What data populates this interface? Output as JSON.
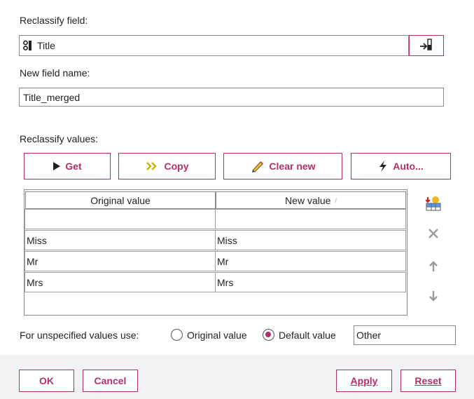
{
  "reclassify_field": {
    "label": "Reclassify field:",
    "value": "Title",
    "field_icon": "nominal-field-icon",
    "picker_icon": "field-picker-icon"
  },
  "new_field_name": {
    "label": "New field name:",
    "value": "Title_merged"
  },
  "reclassify_values": {
    "label": "Reclassify values:",
    "buttons": {
      "get": "Get",
      "copy": "Copy",
      "clear_new": "Clear new",
      "auto": "Auto..."
    }
  },
  "table": {
    "columns": [
      "Original value",
      "New value"
    ],
    "sort_indicator": "/",
    "rows": [
      {
        "original": "",
        "new": ""
      },
      {
        "original": "Miss",
        "new": "Miss"
      },
      {
        "original": "Mr",
        "new": "Mr"
      },
      {
        "original": "Mrs",
        "new": "Mrs"
      }
    ]
  },
  "side_tools": [
    "insert-row-icon",
    "delete-row-icon",
    "move-up-icon",
    "move-down-icon"
  ],
  "unspecified": {
    "label": "For unspecified values use:",
    "option_original": "Original value",
    "option_default": "Default value",
    "selected": "default",
    "default_value": "Other"
  },
  "footer": {
    "ok": "OK",
    "cancel": "Cancel",
    "apply": "Apply",
    "reset": "Reset"
  },
  "colors": {
    "accent": "#b0306a",
    "footer_bg": "#f2f2f5",
    "border": "#8a8a8a"
  }
}
